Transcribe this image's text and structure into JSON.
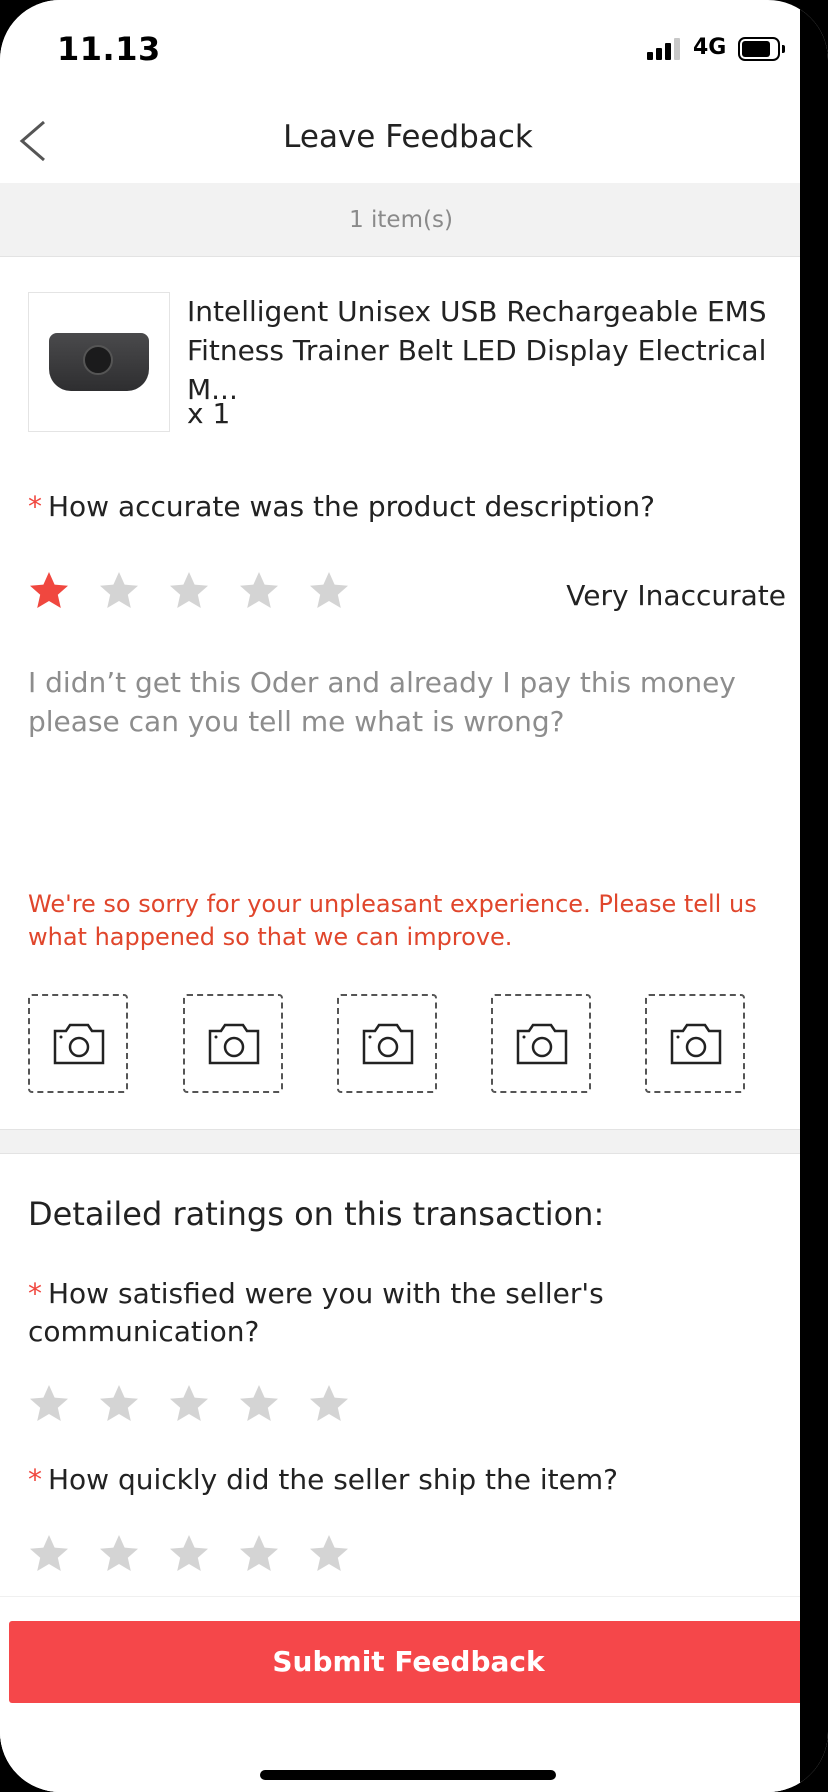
{
  "status_bar": {
    "time": "11.13",
    "network": "4G"
  },
  "nav": {
    "title": "Leave Feedback"
  },
  "items_count": "1 item(s)",
  "product": {
    "name": "Intelligent Unisex USB Rechargeable EMS Fitness Trainer Belt LED Display Electrical M...",
    "quantity": "x 1"
  },
  "question_accuracy": {
    "required_mark": "*",
    "text": "How accurate was the product description?",
    "rating": 1,
    "max_rating": 5,
    "rating_label": "Very Inaccurate"
  },
  "comment": "I didn’t get this Oder and already I pay this money please can you tell me what is wrong?",
  "notice": "We're so sorry for your unpleasant experience. Please tell us what happened so that we can improve.",
  "photo_slots": [
    "camera-icon",
    "camera-icon",
    "camera-icon",
    "camera-icon",
    "camera-icon"
  ],
  "detailed_ratings": {
    "title": "Detailed ratings on this transaction:",
    "communication": {
      "required_mark": "*",
      "text": "How satisfied were you with the seller's communication?",
      "rating": 0,
      "max_rating": 5
    },
    "shipping": {
      "required_mark": "*",
      "text": "How quickly did the seller ship the item?",
      "rating": 0,
      "max_rating": 5
    }
  },
  "submit_label": "Submit Feedback",
  "colors": {
    "accent": "#f5474a",
    "star_active": "#f0473f",
    "star_inactive": "#d4d4d4",
    "notice": "#e0462c"
  }
}
